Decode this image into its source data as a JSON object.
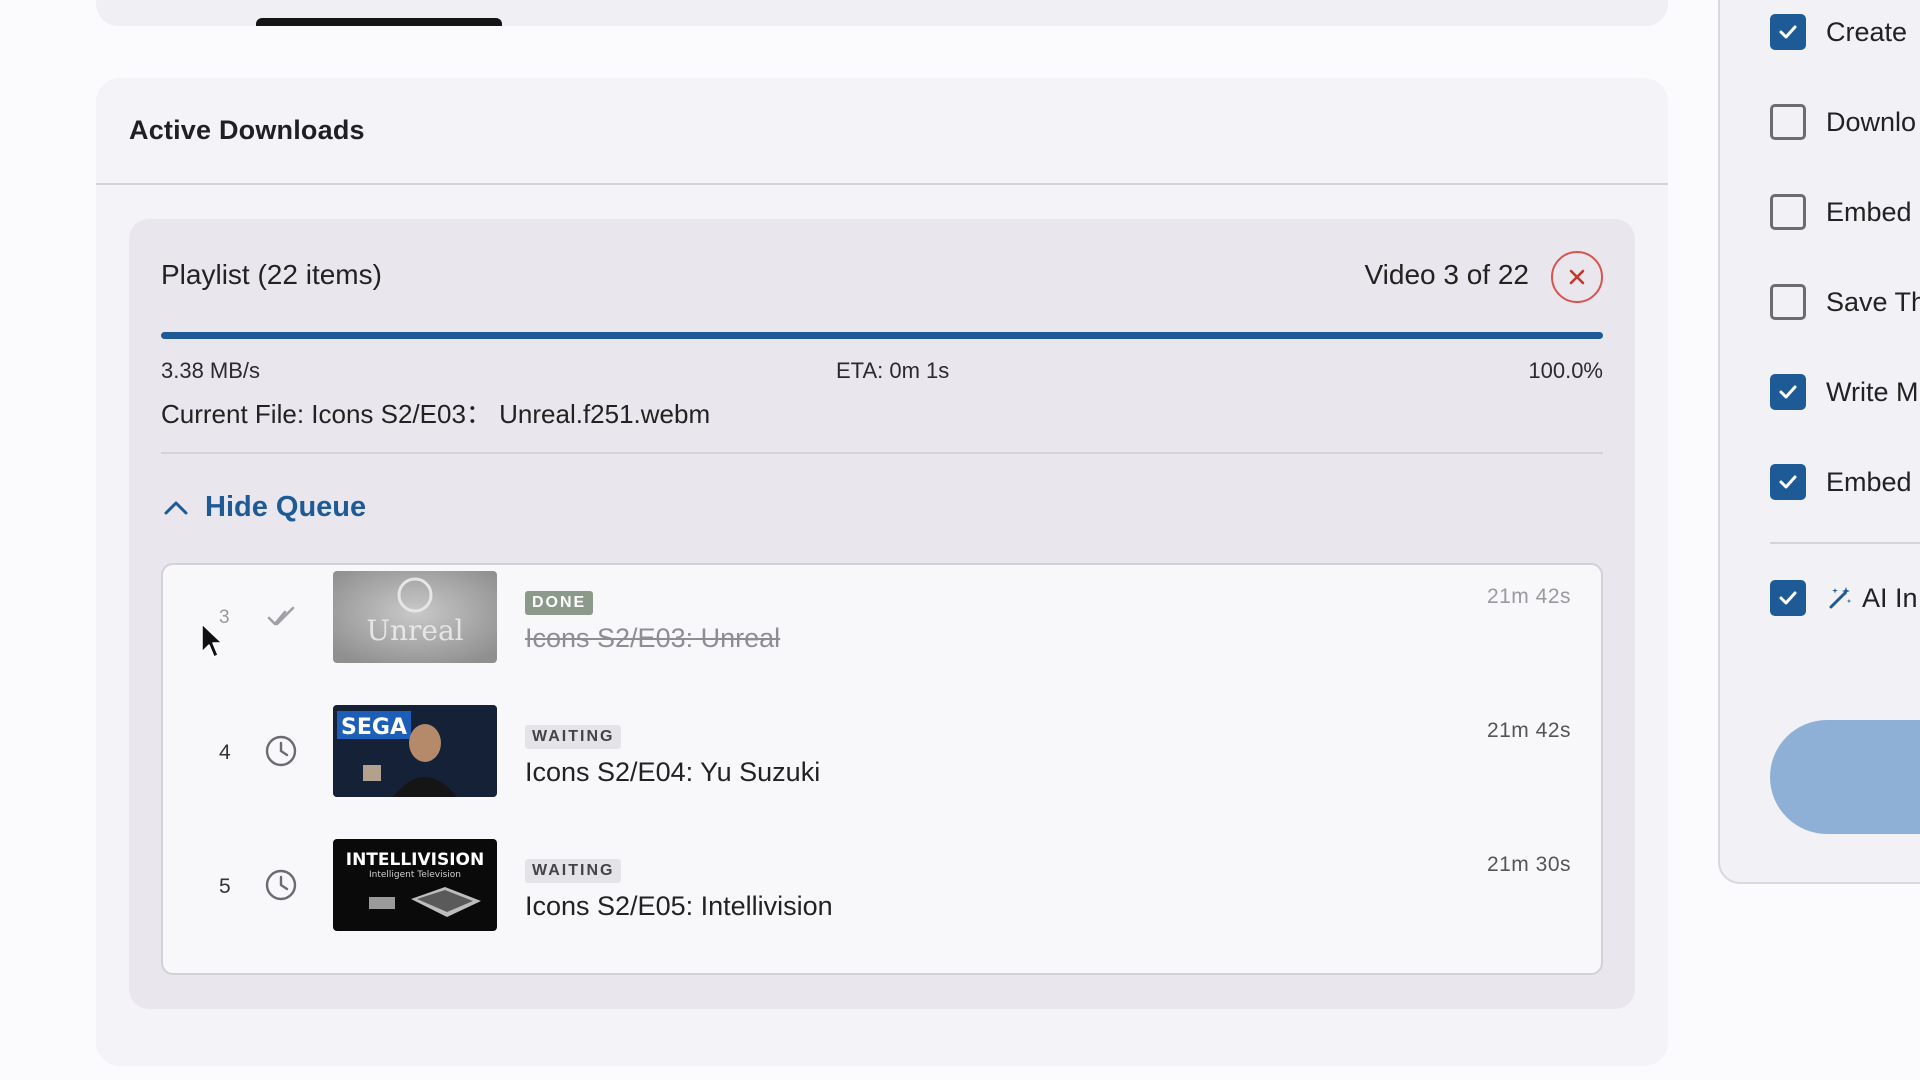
{
  "active_downloads": {
    "title": "Active Downloads",
    "playlist": {
      "title": "Playlist (22 items)",
      "position": "Video 3 of 22",
      "progress_percent": 100.0,
      "speed": "3.38 MB/s",
      "eta": "ETA: 0m 1s",
      "percent_label": "100.0%",
      "current_file": "Current File: Icons S2/E03： Unreal.f251.webm",
      "hide_queue_label": "Hide Queue",
      "queue": [
        {
          "num": "3",
          "status": "done",
          "badge": "DONE",
          "title": "Icons S2/E03: Unreal",
          "duration": "21m 42s",
          "thumb_text": "Unreal"
        },
        {
          "num": "4",
          "status": "waiting",
          "badge": "WAITING",
          "title": "Icons S2/E04: Yu Suzuki",
          "duration": "21m 42s",
          "thumb_text": "SEGA"
        },
        {
          "num": "5",
          "status": "waiting",
          "badge": "WAITING",
          "title": "Icons S2/E05: Intellivision",
          "duration": "21m 30s",
          "thumb_text": "INTELLIVISION",
          "thumb_subtext": "Intelligent Television"
        }
      ]
    }
  },
  "options": [
    {
      "label": "Create",
      "checked": true
    },
    {
      "label": "Downlo",
      "checked": false
    },
    {
      "label": "Embed",
      "checked": false
    },
    {
      "label": "Save Th",
      "checked": false
    },
    {
      "label": "Write M",
      "checked": true
    },
    {
      "label": "Embed",
      "checked": true
    },
    {
      "label": "AI In",
      "checked": true,
      "icon": "magic-wand-icon"
    }
  ],
  "colors": {
    "accent": "#1e5a96",
    "cancel": "#d9534f",
    "card_bg": "#f4f3f7",
    "playlist_bg": "#e9e7ed",
    "done_badge": "#8b9a8b",
    "button_light": "#8fb0d6"
  }
}
